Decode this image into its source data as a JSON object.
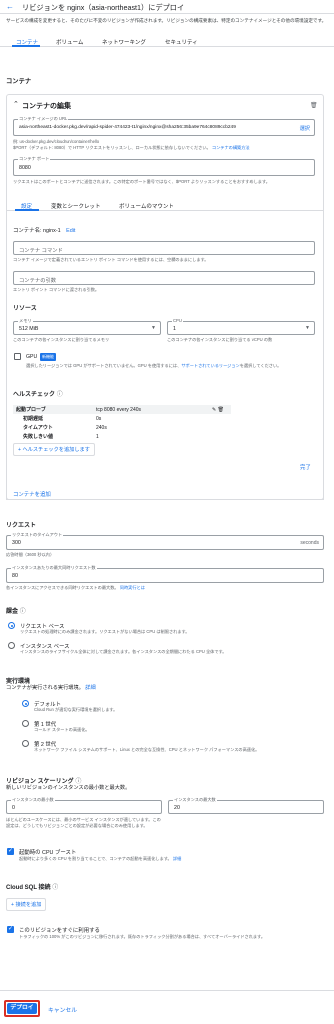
{
  "header": {
    "title": "リビジョンを nginx（asia-northeast1）にデプロイ"
  },
  "intro": "サービスの構成を変更すると、そのたびに不変のリビジョンが作成されます。リビジョンの構成要素は、特定のコンテナイメージとその他の環境設定です。",
  "tabs": [
    "コンテナ",
    "ボリューム",
    "ネットワーキング",
    "セキュリティ"
  ],
  "container_heading": "コンテナ",
  "edit_panel": {
    "title": "コンテナの編集",
    "image_url": {
      "label": "コンテナ イメージの URL",
      "value": "asia-northeast1-docker.pkg.dev/rapid-spider-474423-t1/nginx/nginx@sha256:35ba9e764c8089ccb249",
      "select_label": "選択"
    },
    "image_help": "例: us-docker.pkg.dev/cloudrun/container/hello",
    "image_help2": "$PORT（デフォルト: 8080）で HTTP リクエストをリッスンし、ローカル状態に依存しないでください。",
    "image_help_link": "コンテナの構築方法",
    "port": {
      "label": "コンテナ ポート",
      "value": "8080"
    },
    "port_help": "リクエストはこのポートとコンテナに送信されます。この特定のポート番号ではなく、$PORT よりリッスンすることをおすすめします。",
    "subtabs": [
      "設定",
      "変数とシークレット",
      "ボリュームのマウント"
    ],
    "container_name_label": "コンテナ名: nginx-1",
    "container_name_edit": "Edit",
    "command": {
      "placeholder": "コンテナ コマンド"
    },
    "command_help": "コンテナ イメージで定義されているエントリ ポイント コマンドを使用するには、空欄のままにします。",
    "args": {
      "placeholder": "コンテナの引数"
    },
    "args_help": "エントリ ポイント コマンドに渡される引数。",
    "resources_heading": "リソース",
    "memory": {
      "label": "メモリ",
      "value": "512 MiB"
    },
    "memory_help": "このコンテナの各インスタンスに割り当てるメモリ",
    "cpu": {
      "label": "CPU",
      "value": "1"
    },
    "cpu_help": "このコンテナの各インスタンスに割り当てる vCPU の数",
    "gpu_label": "GPU",
    "gpu_badge": "新機能",
    "gpu_help": "選択したリージョンでは GPU がサポートされていません。GPU を使用するには、",
    "gpu_help_link": "サポートされているリージョン",
    "gpu_help_tail": "を選択してください。",
    "healthcheck_heading": "ヘルスチェック",
    "healthcheck": {
      "probe_label": "起動プローブ",
      "probe_value": "tcp 8080 every 240s",
      "rows": [
        {
          "k": "初期遅延",
          "v": "0s"
        },
        {
          "k": "タイムアウト",
          "v": "240s"
        },
        {
          "k": "失敗しきい値",
          "v": "1"
        }
      ]
    },
    "add_healthcheck": "ヘルスチェックを追加します",
    "done": "完了"
  },
  "add_container": "コンテナを追加",
  "requests": {
    "heading": "リクエスト",
    "timeout": {
      "label": "リクエストのタイムアウト",
      "value": "300",
      "unit": "seconds"
    },
    "timeout_help": "応答時間（3600 秒以内）",
    "concurrency": {
      "label": "インスタンスあたりの最大同時リクエスト数",
      "value": "80"
    },
    "concurrency_help": "各インスタンスにアクセスできる同時リクエストの最大数。",
    "concurrency_link": "詳細",
    "concurrency_link2": "同時実行とは"
  },
  "billing": {
    "heading": "課金",
    "options": [
      {
        "title": "リクエスト ベース",
        "desc": "リクエストの処理時にのみ課金されます。リクエストがない場合は CPU は制限されます。"
      },
      {
        "title": "インスタンス ベース",
        "desc": "インスタンスのライフサイクル全体に対して課金されます。各インスタンスの全期間にわたる CPU 全体です。"
      }
    ]
  },
  "environment": {
    "heading": "実行環境",
    "sub": "コンテナが実行される実行環境。",
    "sub_link": "詳細",
    "options": [
      {
        "title": "デフォルト",
        "desc": "Cloud Run が適切な実行環境を選択します。"
      },
      {
        "title": "第 1 世代",
        "desc": "コールド スタートの高速化。"
      },
      {
        "title": "第 2 世代",
        "desc": "ネットワーク ファイル システムのサポート、Linux との完全な互換性、CPU とネットワーク パフォーマンスの高速化。"
      }
    ]
  },
  "scaling": {
    "heading": "リビジョン スケーリング",
    "sub": "新しいリビジョンのインスタンスの最小数と最大数。",
    "min": {
      "label": "インスタンスの最小数",
      "value": "0"
    },
    "max": {
      "label": "インスタンスの最大数",
      "value": "20"
    },
    "min_help": "ほとんどのユースケースには、最小のサービス インスタンスが適しています。この設定は、どうしてもリビジョンごとの設定が必要な場合にのみ使用します。",
    "startup_boost": "起動時の CPU ブースト",
    "startup_boost_help": "起動時により多くの CPU を割り当てることで、コンテナの起動を高速化します。",
    "startup_boost_link": "詳細"
  },
  "cloudsql": {
    "heading": "Cloud SQL 接続",
    "add": "接続を追加"
  },
  "serve": {
    "title": "このリビジョンをすぐに利用する",
    "desc": "トラフィックの 100% がこのリビジョンに移行されます。既存のトラフィック分割がある場合は、すべてオーバーライドされます。"
  },
  "footer": {
    "deploy": "デプロイ",
    "cancel": "キャンセル"
  }
}
